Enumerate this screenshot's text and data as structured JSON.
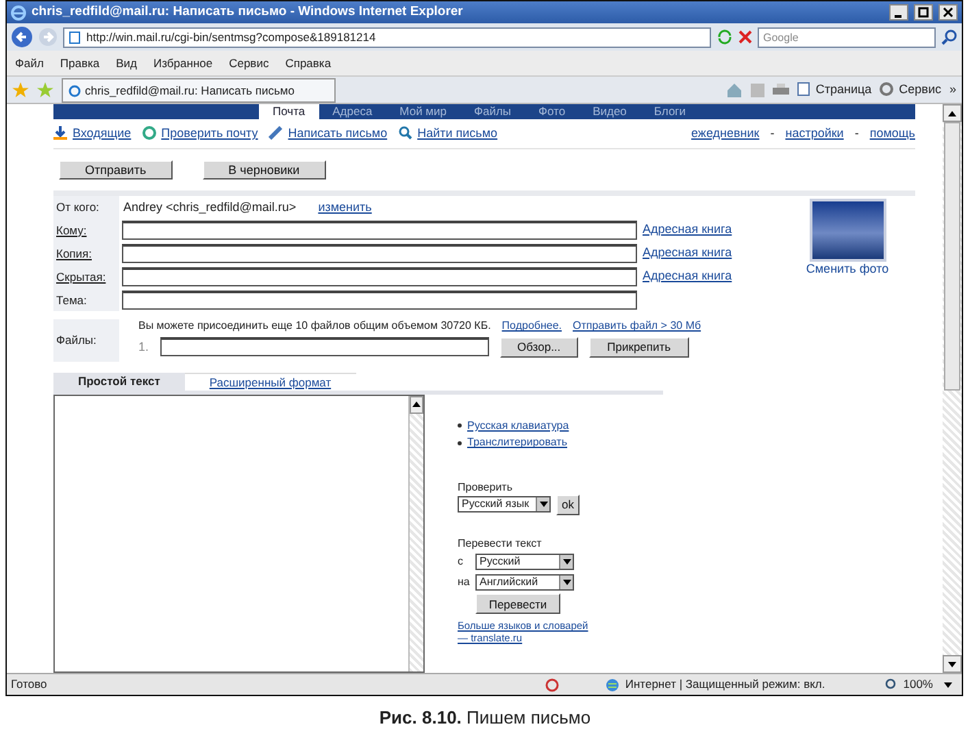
{
  "window": {
    "title": "chris_redfild@mail.ru: Написать письмо - Windows Internet Explorer",
    "url": "http://win.mail.ru/cgi-bin/sentmsg?compose&189181214",
    "search_placeholder": "Google"
  },
  "menu": [
    "Файл",
    "Правка",
    "Вид",
    "Избранное",
    "Сервис",
    "Справка"
  ],
  "browser_tab": {
    "title": "chris_redfild@mail.ru: Написать письмо"
  },
  "command_bar": {
    "page": "Страница",
    "tools": "Сервис",
    "more": "»"
  },
  "site_tabs": [
    {
      "label": "Почта",
      "selected": true
    },
    {
      "label": "Адреса",
      "selected": false
    },
    {
      "label": "Мой мир",
      "selected": false
    },
    {
      "label": "Файлы",
      "selected": false
    },
    {
      "label": "Фото",
      "selected": false
    },
    {
      "label": "Видео",
      "selected": false
    },
    {
      "label": "Блоги",
      "selected": false
    }
  ],
  "mail_links": [
    {
      "label": "Входящие",
      "kind": "inbox"
    },
    {
      "label": "Проверить почту",
      "kind": "check"
    },
    {
      "label": "Написать письмо",
      "kind": "compose"
    },
    {
      "label": "Найти письмо",
      "kind": "search"
    }
  ],
  "top_links": {
    "separator": "-",
    "items": [
      "ежедневник",
      "настройки",
      "помощь"
    ]
  },
  "actions": [
    "Отправить",
    "В черновики"
  ],
  "from": {
    "label": "От кого:",
    "value": "Andrey  <chris_redfild@mail.ru>",
    "link": "изменить"
  },
  "fields": [
    {
      "label": "Кому:",
      "linked": true,
      "link": "Адресная книга"
    },
    {
      "label": "Копия:",
      "linked": true,
      "link": "Адресная книга"
    },
    {
      "label": "Скрытая:",
      "linked": true,
      "link": "Адресная книга"
    },
    {
      "label": "Тема:",
      "linked": false
    }
  ],
  "photo": {
    "link": "Сменить фото"
  },
  "files": {
    "label": "Файлы:",
    "note": "Вы можете присоединить еще 10 файлов общим объемом 30720 КБ.",
    "more": "Подробнее.",
    "big": "Отправить файл > 30 Мб",
    "index": "1.",
    "browse": "Обзор...",
    "attach": "Прикрепить"
  },
  "editor_tabs": [
    {
      "label": "Простой текст",
      "selected": true
    },
    {
      "label": "Расширенный формат",
      "selected": false
    }
  ],
  "tools": {
    "links": [
      "Русская клавиатура",
      "Транслитерировать"
    ],
    "check_label": "Проверить",
    "check_value": "Русский язык",
    "check_button": "ok",
    "translate_label": "Перевести текст",
    "from_label": "с",
    "from_value": "Русский",
    "to_label": "на",
    "to_value": "Английский",
    "translate_button": "Перевести",
    "more_link": "Больше языков и словарей — translate.ru"
  },
  "status_bar": {
    "text": "Готово",
    "zone": "Интернет | Защищенный режим: вкл.",
    "zoom": "100%"
  },
  "caption": "**Рис. 8.10.** Пишем письмо"
}
